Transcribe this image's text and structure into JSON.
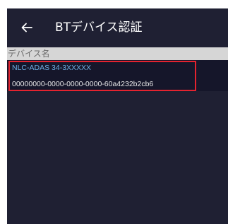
{
  "header": {
    "back_icon": "arrow-left-icon",
    "title": "BTデバイス認証"
  },
  "section": {
    "label": "デバイス名"
  },
  "devices": [
    {
      "name": "NLC-ADAS 34-3XXXXX",
      "id": "00000000-0000-0000-0000-60a4232b2cb6"
    }
  ],
  "colors": {
    "background": "#1f2033",
    "list_item_background": "#15162a",
    "section_header_background": "#d6d6d6",
    "device_name": "#6fb0e6",
    "highlight_border": "#e5232f"
  }
}
